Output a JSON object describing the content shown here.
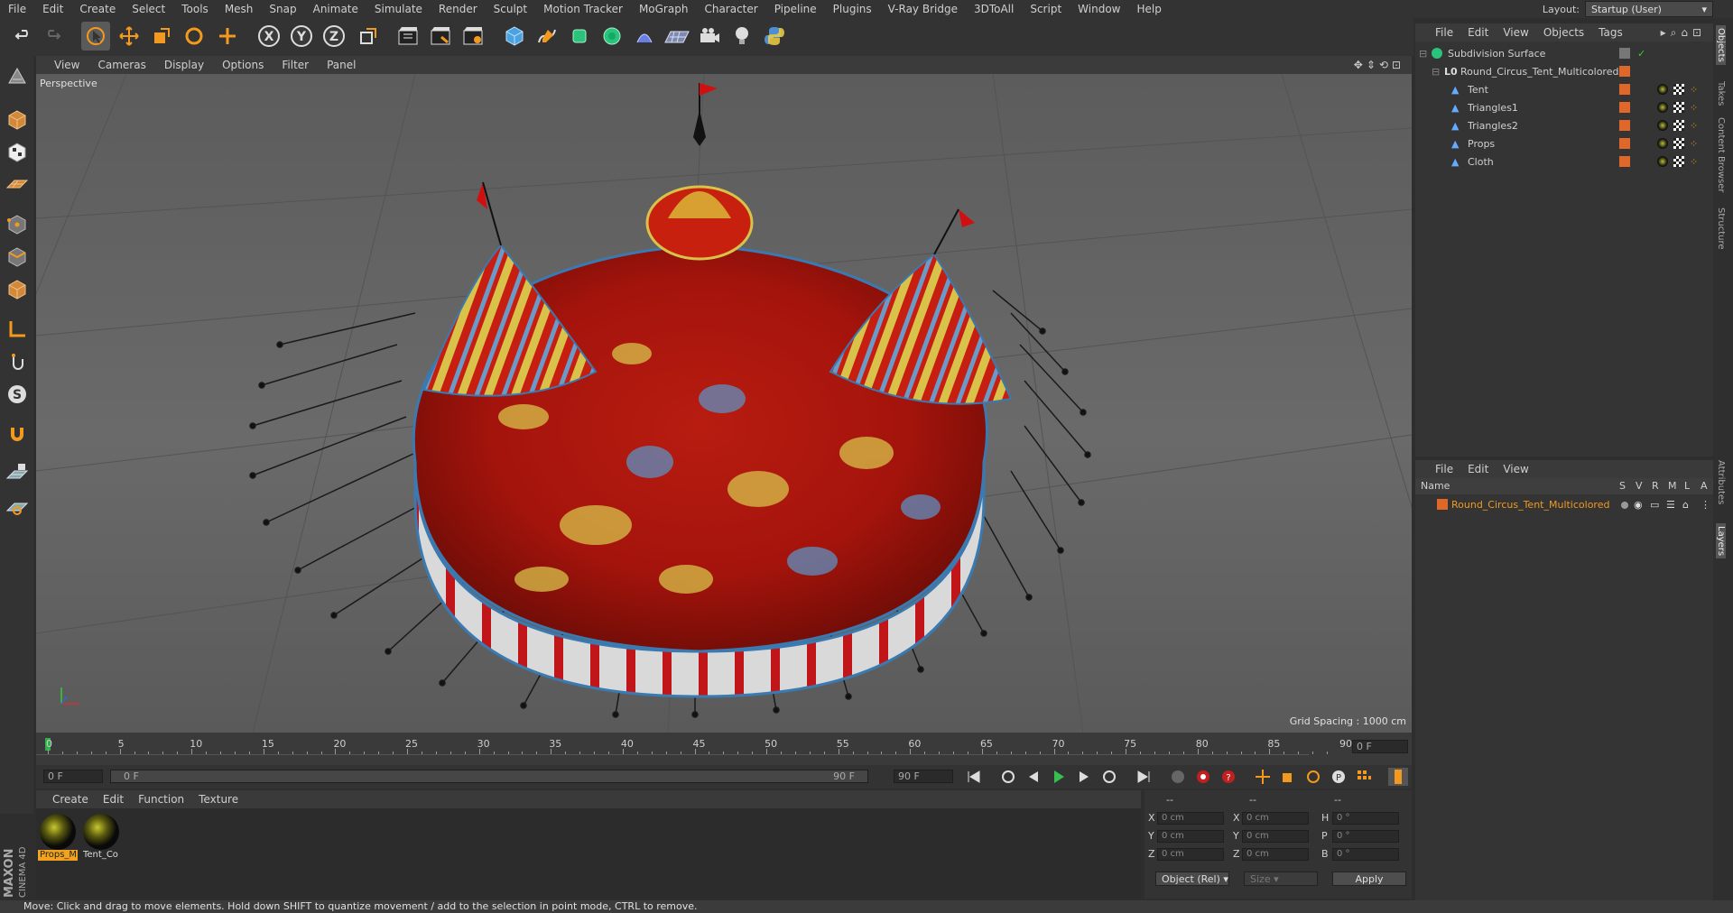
{
  "menubar": {
    "items": [
      "File",
      "Edit",
      "Create",
      "Select",
      "Tools",
      "Mesh",
      "Snap",
      "Animate",
      "Simulate",
      "Render",
      "Sculpt",
      "Motion Tracker",
      "MoGraph",
      "Character",
      "Pipeline",
      "Plugins",
      "V-Ray Bridge",
      "3DToAll",
      "Script",
      "Window",
      "Help"
    ],
    "layout_label": "Layout:",
    "layout_value": "Startup (User)"
  },
  "toolbar": {
    "icons": [
      "undo-icon",
      "redo-icon",
      "select-arrow-icon",
      "move-icon",
      "scale-icon",
      "rotate-icon",
      "add-icon",
      "x-axis-icon",
      "y-axis-icon",
      "z-axis-icon",
      "coordinate-system-icon",
      "render-view-icon",
      "render-picture-viewer-icon",
      "render-settings-icon",
      "cube-primitive-icon",
      "pen-spline-icon",
      "nurbs-icon",
      "array-icon",
      "deformer-icon",
      "floor-icon",
      "camera-icon",
      "light-icon",
      "python-icon"
    ],
    "axis_labels": [
      "X",
      "Y",
      "Z"
    ]
  },
  "viewport": {
    "menu": [
      "View",
      "Cameras",
      "Display",
      "Options",
      "Filter",
      "Panel"
    ],
    "label": "Perspective",
    "grid_spacing": "Grid Spacing : 1000 cm"
  },
  "timeline": {
    "ticks": [
      "0",
      "5",
      "10",
      "15",
      "20",
      "25",
      "30",
      "35",
      "40",
      "45",
      "50",
      "55",
      "60",
      "65",
      "70",
      "75",
      "80",
      "85",
      "90"
    ],
    "current_frame": "0 F",
    "start_field": "0 F",
    "range_start": "0 F",
    "range_end": "90 F",
    "end_field": "90 F"
  },
  "materials": {
    "menu": [
      "Create",
      "Edit",
      "Function",
      "Texture"
    ],
    "items": [
      {
        "label": "Props_M",
        "selected": true
      },
      {
        "label": "Tent_Co",
        "selected": false
      }
    ]
  },
  "coordinates": {
    "headers": [
      "--",
      "--",
      "--"
    ],
    "rows": [
      {
        "a": "X",
        "av": "0 cm",
        "b": "X",
        "bv": "0 cm",
        "c": "H",
        "cv": "0 °"
      },
      {
        "a": "Y",
        "av": "0 cm",
        "b": "Y",
        "bv": "0 cm",
        "c": "P",
        "cv": "0 °"
      },
      {
        "a": "Z",
        "av": "0 cm",
        "b": "Z",
        "bv": "0 cm",
        "c": "B",
        "cv": "0 °"
      }
    ],
    "mode": "Object (Rel)",
    "size_mode": "Size",
    "apply": "Apply"
  },
  "objects": {
    "menu": [
      "File",
      "Edit",
      "View",
      "Objects",
      "Tags"
    ],
    "tree": [
      {
        "name": "Subdivision Surface",
        "level": 0
      },
      {
        "name": "Round_Circus_Tent_Multicolored",
        "level": 1
      },
      {
        "name": "Tent",
        "level": 2
      },
      {
        "name": "Triangles1",
        "level": 2
      },
      {
        "name": "Triangles2",
        "level": 2
      },
      {
        "name": "Props",
        "level": 2
      },
      {
        "name": "Cloth",
        "level": 2
      }
    ]
  },
  "layers": {
    "menu": [
      "File",
      "Edit",
      "View"
    ],
    "columns": [
      "Name",
      "S",
      "V",
      "R",
      "M",
      "L",
      "A"
    ],
    "rows": [
      {
        "name": "Round_Circus_Tent_Multicolored"
      }
    ]
  },
  "side_tabs": [
    "Objects",
    "Takes",
    "Content Browser",
    "Structure",
    "Attributes",
    "Layers"
  ],
  "status": "Move: Click and drag to move elements. Hold down SHIFT to quantize movement / add to the selection in point mode, CTRL to remove.",
  "brand": {
    "line1": "MAXON",
    "line2": "CINEMA 4D"
  },
  "colors": {
    "accent": "#f39a1e",
    "selected_material": "#f3a21e",
    "object_orange": "#e0672a"
  }
}
